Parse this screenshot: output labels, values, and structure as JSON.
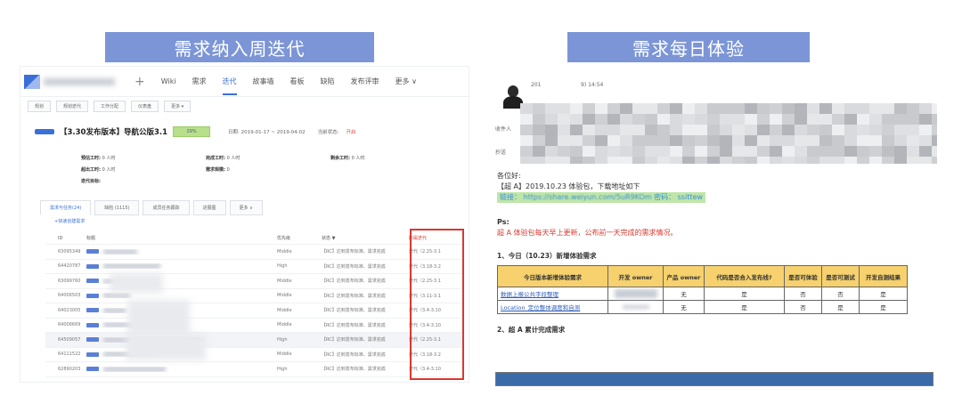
{
  "banners": {
    "left": "需求纳入周迭代",
    "right": "需求每日体验"
  },
  "left": {
    "topnav": {
      "plus": "+",
      "items": [
        "Wiki",
        "需求",
        "迭代",
        "故事墙",
        "看板",
        "缺陷",
        "发布评审",
        "更多 ∨"
      ],
      "active_index": 2
    },
    "toolbar": [
      "规划",
      "规划迭代",
      "工作分配",
      "仪表盘",
      "更多 ▾"
    ],
    "iteration": {
      "title": "【3.30发布版本】导航公版3.1",
      "progress": "29%",
      "progress_value": 29,
      "date": "日期: 2019-01-17 ~ 2019-04-02",
      "status_label": "当前状态:",
      "status": "开启"
    },
    "stats": [
      [
        {
          "k": "预估工时:",
          "v": "0 人时"
        },
        {
          "k": "完成工时:",
          "v": "0 人时"
        },
        {
          "k": "剩余工时:",
          "v": "0 人时"
        }
      ],
      [
        {
          "k": "超出工时:",
          "v": "0 人时"
        },
        {
          "k": "需求规模:",
          "v": "0"
        },
        {
          "k": "",
          "v": ""
        }
      ],
      [
        {
          "k": "迭代目标:",
          "v": ""
        },
        {
          "k": "",
          "v": ""
        },
        {
          "k": "",
          "v": ""
        }
      ]
    ],
    "tabs": [
      "需求与任务(24)",
      "缺陷 (1115)",
      "成员任务跟踪",
      "进展图",
      "更多 ∨"
    ],
    "add_quick": "+快速创建需求",
    "columns": [
      "ID",
      "标题",
      "优先级",
      "状态 ▼",
      "所属迭代"
    ],
    "rows": [
      {
        "id": "63095349",
        "title": "",
        "priority": "Middle",
        "status": "【RC】达到发布标准、需求完成",
        "iteration": "迭代（2.25-3.1"
      },
      {
        "id": "64420787",
        "title": "",
        "priority": "High",
        "status": "【RC】达到发布标准、需求完成",
        "iteration": "迭代（3.18-3.2"
      },
      {
        "id": "63099760",
        "title": "",
        "priority": "Middle",
        "status": "【RC】达到发布标准、需求完成",
        "iteration": "迭代（2.25-3.1"
      },
      {
        "id": "64006503",
        "title": "",
        "priority": "Middle",
        "status": "【RC】达到发布标准、需求完成",
        "iteration": "迭代（3.11-3.1"
      },
      {
        "id": "64023005",
        "title": "",
        "priority": "Middle",
        "status": "【RC】达到发布标准、需求完成",
        "iteration": "迭代（3.4-3.10"
      },
      {
        "id": "64006669",
        "title": "",
        "priority": "Middle",
        "status": "【RC】达到发布标准、需求完成",
        "iteration": "迭代（3.4-3.10"
      },
      {
        "id": "64509057",
        "title": "",
        "priority": "High",
        "status": "【RC】达到发布标准、需求完成",
        "iteration": "迭代（2.25-3.1"
      },
      {
        "id": "64111522",
        "title": "",
        "priority": "Middle",
        "status": "【RC】达到发布标准、需求完成",
        "iteration": "迭代（3.18-3.2"
      },
      {
        "id": "62890203",
        "title": "",
        "priority": "High",
        "status": "【RC】达到发布标准、需求完成",
        "iteration": "迭代（3.4-3.10"
      }
    ]
  },
  "right": {
    "header": {
      "from_prefix": "201",
      "time": "9) 14:54",
      "to": "收件人",
      "cc": "抄送"
    },
    "greeting": "各位好:",
    "line1": "【超 A】2019.10.23 体验包，下载地址如下",
    "link_label": "链接：",
    "link": "https://share.weiyun.com/5uR9KOm",
    "pwd_label": "密码：",
    "pwd": "ssittew",
    "ps": "Ps:",
    "ps_text": "超 A 体验包每天早上更新，公布前一天完成的需求情况。",
    "section1": "1、今日（10.23）新增体验需求",
    "table_headers": [
      "今日版本新增体验需求",
      "开发 owner",
      "产品 owner",
      "代码是否合入发布线?",
      "是否可体验",
      "是否可测试",
      "开发自测结果"
    ],
    "table_rows": [
      [
        "数据上报公共字段整理",
        "",
        "无",
        "是",
        "否",
        "否",
        "是"
      ],
      [
        "Location_定位整体调度和自测",
        "",
        "无",
        "是",
        "否",
        "是",
        "是"
      ]
    ],
    "section2": "2、超 A 累计完成需求"
  }
}
